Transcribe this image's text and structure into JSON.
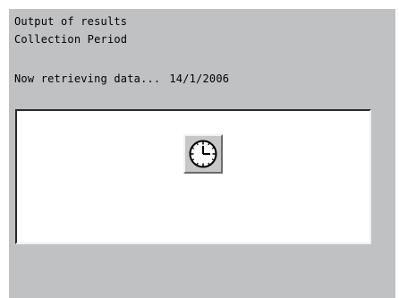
{
  "screen": {
    "title": "Output of results",
    "subtitle": "Collection Period",
    "status_text": "Now retrieving data...",
    "status_date": "14/1/2006"
  },
  "panel": {
    "icon": "clock-icon"
  },
  "colors": {
    "screen_background": "#bfc1c3",
    "panel_background": "#ffffff",
    "button_face": "#c6c7c8"
  }
}
